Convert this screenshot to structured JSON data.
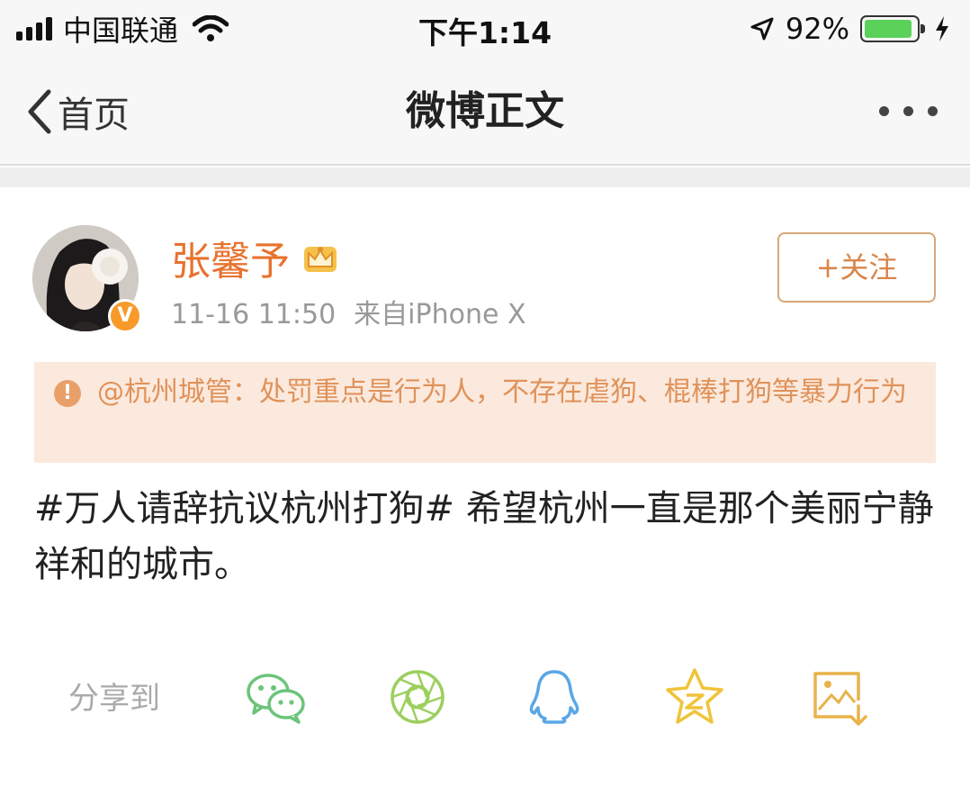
{
  "status_bar": {
    "carrier": "中国联通",
    "time": "下午1:14",
    "battery_percent": "92%",
    "battery_level": 0.92
  },
  "nav": {
    "back_label": "首页",
    "title": "微博正文"
  },
  "post": {
    "username": "张馨予",
    "timestamp": "11-16 11:50",
    "source": "来自iPhone X",
    "follow_label": "+关注",
    "verified_badge": "V",
    "notice_text": "@杭州城管：处罚重点是行为人，不存在虐狗、棍棒打狗等暴力行为",
    "content": "#万人请辞抗议杭州打狗# 希望杭州一直是那个美丽宁静祥和的城市。"
  },
  "share": {
    "label": "分享到",
    "targets": [
      "wechat-icon",
      "moments-icon",
      "qq-icon",
      "qzone-icon",
      "save-image-icon"
    ]
  },
  "colors": {
    "accent_orange": "#e8722f",
    "notice_bg": "#fbe9dd",
    "notice_text": "#e0925a",
    "share_green": "#6cc47a",
    "share_blue": "#5aa7e6",
    "share_yellow": "#f0c43a"
  }
}
